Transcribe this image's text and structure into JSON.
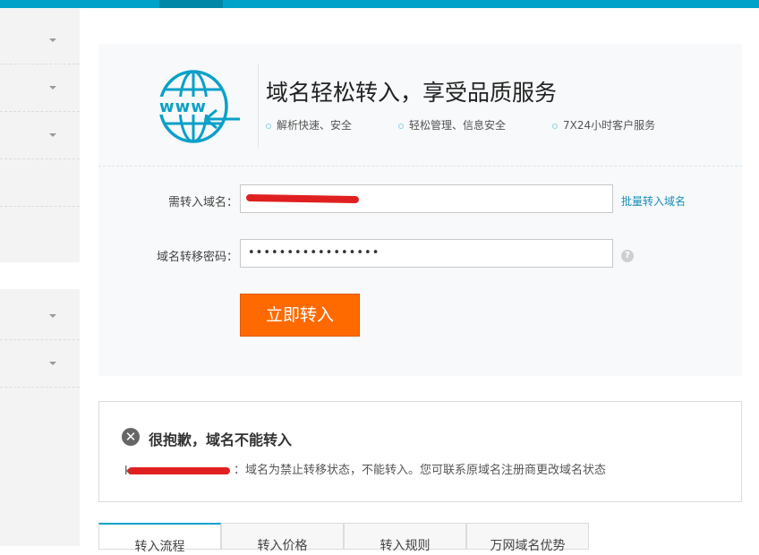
{
  "sidebar": {
    "group1_items": 5,
    "group2_items": 2
  },
  "header": {
    "title": "域名轻松转入，享受品质服务",
    "features": [
      "解析快速、安全",
      "轻松管理、信息安全",
      "7X24小时客户服务"
    ]
  },
  "form": {
    "domain_label": "需转入域名：",
    "domain_value": "",
    "batch_link": "批量转入域名",
    "password_label": "域名转移密码：",
    "password_value": "•••••••••••••••••",
    "help_icon": "?",
    "submit_label": "立即转入"
  },
  "error": {
    "icon": "✕",
    "title": "很抱歉，域名不能转入",
    "domain_prefix": "k",
    "message": "：域名为禁止转移状态，不能转入。您可联系原域名注册商更改域名状态"
  },
  "tabs": [
    "转入流程",
    "转入价格",
    "转入规则",
    "万网域名优势"
  ],
  "colors": {
    "accent": "#00a2ca",
    "button": "#ff6a00",
    "link": "#1a8fb8"
  }
}
